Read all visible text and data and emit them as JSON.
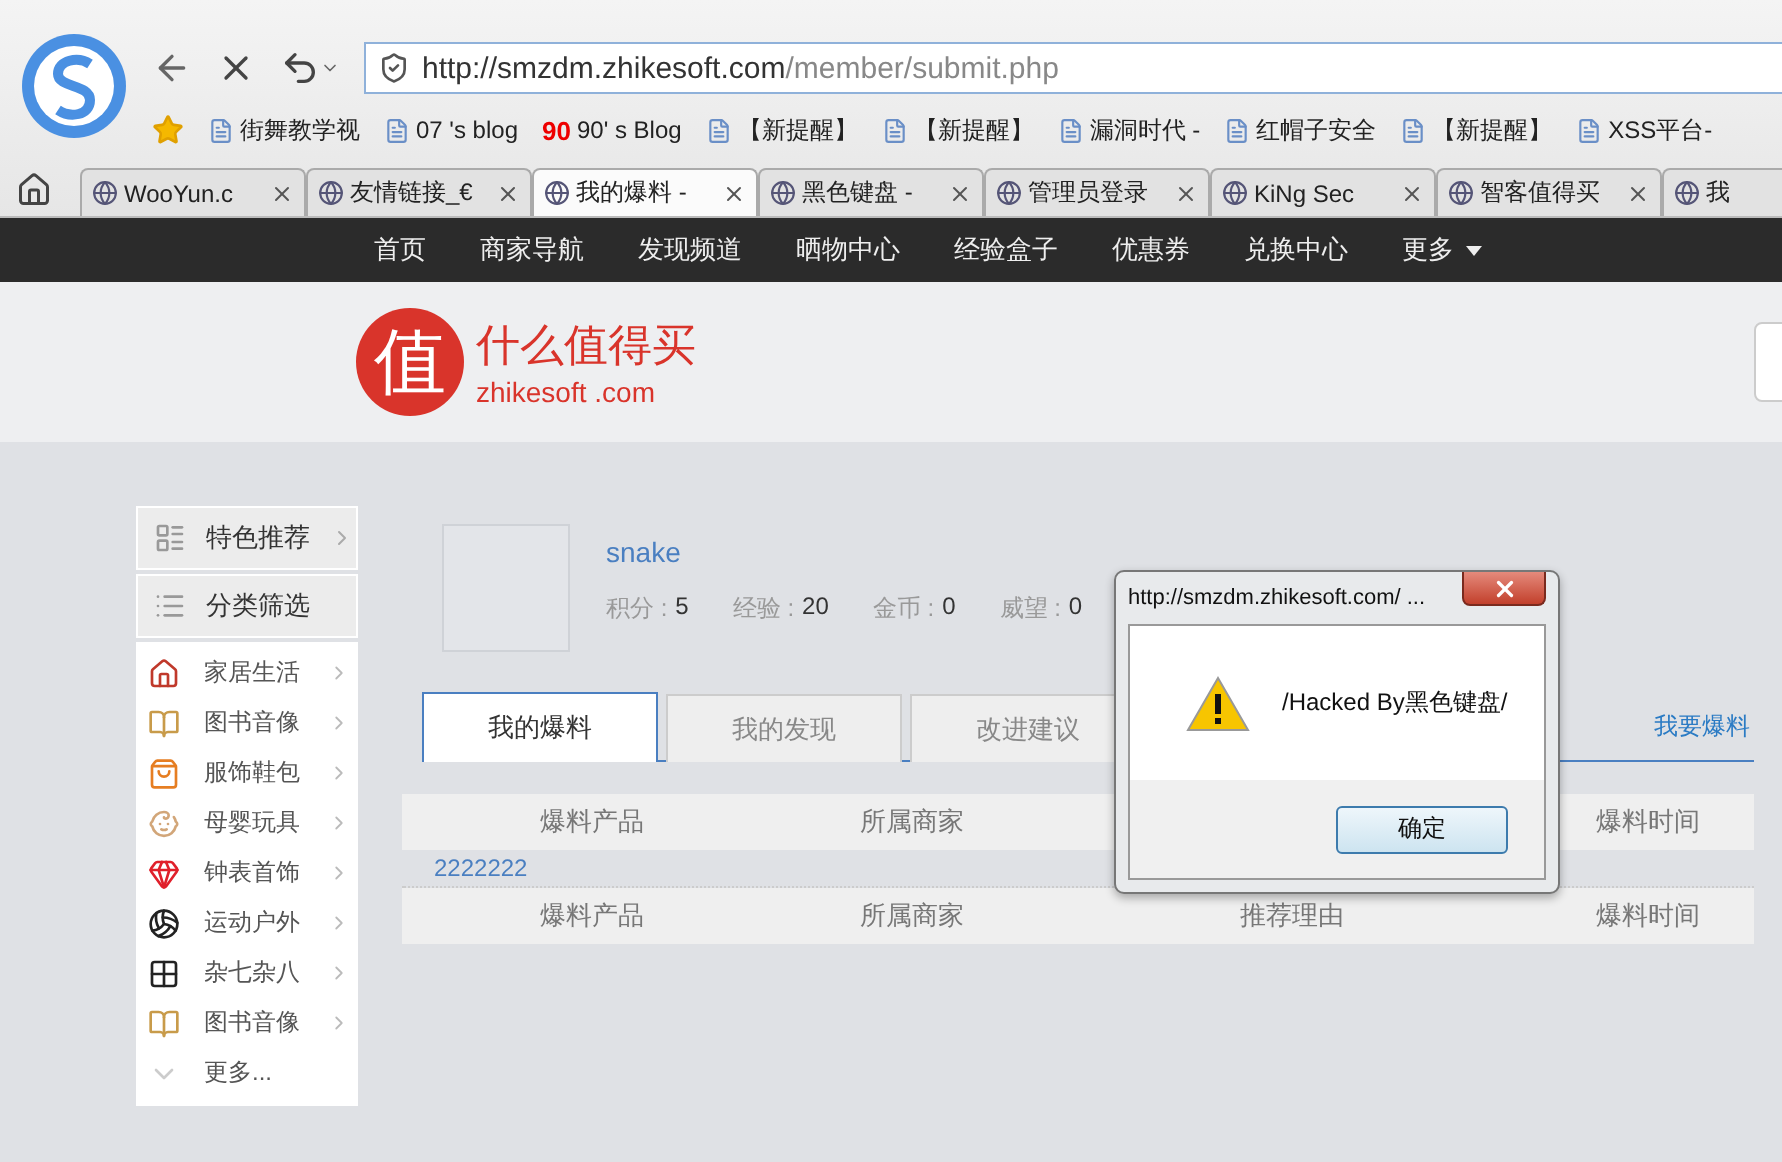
{
  "browser": {
    "url_host": "http://smzdm.zhikesoft.com",
    "url_path": "/member/submit.php",
    "bookmarks": [
      {
        "label": "街舞教学视"
      },
      {
        "label": "07 's blog"
      },
      {
        "label": "90' s Blog",
        "favicon_text": "90"
      },
      {
        "label": "【新提醒】"
      },
      {
        "label": "【新提醒】"
      },
      {
        "label": "漏洞时代 -"
      },
      {
        "label": "红帽子安全"
      },
      {
        "label": "【新提醒】"
      },
      {
        "label": "XSS平台-"
      }
    ],
    "tabs": [
      {
        "label": "WooYun.c",
        "selected": false
      },
      {
        "label": "友情链接_€",
        "selected": false
      },
      {
        "label": "我的爆料 -",
        "selected": true
      },
      {
        "label": "黑色键盘 -",
        "selected": false
      },
      {
        "label": "管理员登录",
        "selected": false
      },
      {
        "label": "KiNg Sec",
        "selected": false
      },
      {
        "label": "智客值得买",
        "selected": false
      },
      {
        "label": "我",
        "selected": false
      }
    ]
  },
  "site_nav": [
    "首页",
    "商家导航",
    "发现频道",
    "晒物中心",
    "经验盒子",
    "优惠券",
    "兑换中心",
    "更多"
  ],
  "logo": {
    "name": "什么值得买",
    "domain": "zhikesoft .com",
    "mark": "值"
  },
  "sidebar": {
    "headers": [
      {
        "label": "特色推荐",
        "chevron": true
      },
      {
        "label": "分类筛选",
        "chevron": false
      }
    ],
    "items": [
      "家居生活",
      "图书音像",
      "服饰鞋包",
      "母婴玩具",
      "钟表首饰",
      "运动户外",
      "杂七杂八",
      "图书音像"
    ],
    "more": "更多..."
  },
  "profile": {
    "username": "snake",
    "stats": [
      {
        "label": "积分 :",
        "value": "5"
      },
      {
        "label": "经验 :",
        "value": "20"
      },
      {
        "label": "金币 :",
        "value": "0"
      },
      {
        "label": "威望 :",
        "value": "0"
      }
    ]
  },
  "content_tabs": [
    {
      "label": "我的爆料",
      "selected": true
    },
    {
      "label": "我的发现",
      "selected": false
    },
    {
      "label": "改进建议",
      "selected": false
    }
  ],
  "submit_link": "我要爆料",
  "table": {
    "header_1": [
      "爆料产品",
      "所属商家",
      "爆料时间"
    ],
    "row": "2222222",
    "header_2": [
      "爆料产品",
      "所属商家",
      "推荐理由",
      "爆料时间"
    ]
  },
  "dialog": {
    "title": "http://smzdm.zhikesoft.com/ ...",
    "message": "/Hacked By黑色键盘/",
    "button": "确定"
  }
}
